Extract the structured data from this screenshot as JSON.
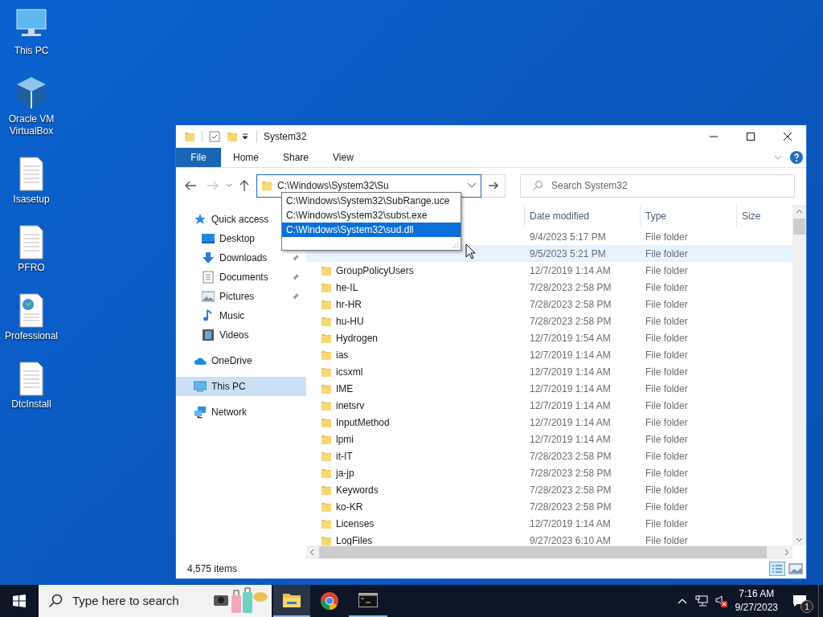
{
  "desktop_icons": [
    {
      "label": "This PC",
      "kind": "pc"
    },
    {
      "label": "Oracle VM VirtualBox",
      "kind": "vbox"
    },
    {
      "label": "Isasetup",
      "kind": "doc"
    },
    {
      "label": "PFRO",
      "kind": "doc"
    },
    {
      "label": "Professional",
      "kind": "webdoc"
    },
    {
      "label": "DtcInstall",
      "kind": "doc"
    }
  ],
  "window": {
    "title": "System32",
    "file_tab": "File",
    "ribbon_tabs": [
      "Home",
      "Share",
      "View"
    ],
    "address": {
      "value": "C:\\Windows\\System32\\Su"
    },
    "suggestions": [
      {
        "text": "C:\\Windows\\System32\\SubRange.uce",
        "selected": false
      },
      {
        "text": "C:\\Windows\\System32\\subst.exe",
        "selected": false
      },
      {
        "text": "C:\\Windows\\System32\\sud.dll",
        "selected": true
      }
    ],
    "search": {
      "placeholder": "Search System32"
    },
    "nav": [
      {
        "label": "Quick access",
        "kind": "star",
        "selected": false,
        "children": [
          {
            "label": "Desktop",
            "kind": "desktop",
            "pinned": false,
            "selected": false
          },
          {
            "label": "Downloads",
            "kind": "download",
            "pinned": true,
            "selected": false
          },
          {
            "label": "Documents",
            "kind": "documents",
            "pinned": true,
            "selected": false
          },
          {
            "label": "Pictures",
            "kind": "pictures",
            "pinned": true,
            "selected": false
          },
          {
            "label": "Music",
            "kind": "music",
            "pinned": false,
            "selected": false
          },
          {
            "label": "Videos",
            "kind": "videos",
            "pinned": false,
            "selected": false
          }
        ]
      },
      {
        "label": "OneDrive",
        "kind": "cloud",
        "selected": false
      },
      {
        "label": "This PC",
        "kind": "pc",
        "selected": true
      },
      {
        "label": "Network",
        "kind": "network",
        "selected": false
      }
    ],
    "columns": [
      "Date modified",
      "Type",
      "Size"
    ],
    "rows": [
      {
        "date": "9/4/2023 5:17 PM",
        "type": "File folder",
        "hovered": false
      },
      {
        "date": "9/5/2023 5:21 PM",
        "type": "File folder",
        "hovered": true
      },
      {
        "name": "GroupPolicyUsers",
        "date": "12/7/2019 1:14 AM",
        "type": "File folder",
        "hovered": false
      },
      {
        "name": "he-IL",
        "date": "7/28/2023 2:58 PM",
        "type": "File folder",
        "hovered": false
      },
      {
        "name": "hr-HR",
        "date": "7/28/2023 2:58 PM",
        "type": "File folder",
        "hovered": false
      },
      {
        "name": "hu-HU",
        "date": "7/28/2023 2:58 PM",
        "type": "File folder",
        "hovered": false
      },
      {
        "name": "Hydrogen",
        "date": "12/7/2019 1:54 AM",
        "type": "File folder",
        "hovered": false
      },
      {
        "name": "ias",
        "date": "12/7/2019 1:14 AM",
        "type": "File folder",
        "hovered": false
      },
      {
        "name": "icsxml",
        "date": "12/7/2019 1:14 AM",
        "type": "File folder",
        "hovered": false
      },
      {
        "name": "IME",
        "date": "12/7/2019 1:14 AM",
        "type": "File folder",
        "hovered": false
      },
      {
        "name": "inetsrv",
        "date": "12/7/2019 1:14 AM",
        "type": "File folder",
        "hovered": false
      },
      {
        "name": "InputMethod",
        "date": "12/7/2019 1:14 AM",
        "type": "File folder",
        "hovered": false
      },
      {
        "name": "lpmi",
        "date": "12/7/2019 1:14 AM",
        "type": "File folder",
        "hovered": false
      },
      {
        "name": "it-IT",
        "date": "7/28/2023 2:58 PM",
        "type": "File folder",
        "hovered": false
      },
      {
        "name": "ja-jp",
        "date": "7/28/2023 2:58 PM",
        "type": "File folder",
        "hovered": false
      },
      {
        "name": "Keywords",
        "date": "7/28/2023 2:58 PM",
        "type": "File folder",
        "hovered": false
      },
      {
        "name": "ko-KR",
        "date": "7/28/2023 2:58 PM",
        "type": "File folder",
        "hovered": false
      },
      {
        "name": "Licenses",
        "date": "12/7/2019 1:14 AM",
        "type": "File folder",
        "hovered": false
      },
      {
        "name": "LogFiles",
        "date": "9/27/2023 6:10 AM",
        "type": "File folder",
        "hovered": false
      }
    ],
    "status": "4,575 items"
  },
  "taskbar": {
    "search_placeholder": "Type here to search",
    "time": "7:16 AM",
    "date": "9/27/2023",
    "notifications": "1"
  }
}
